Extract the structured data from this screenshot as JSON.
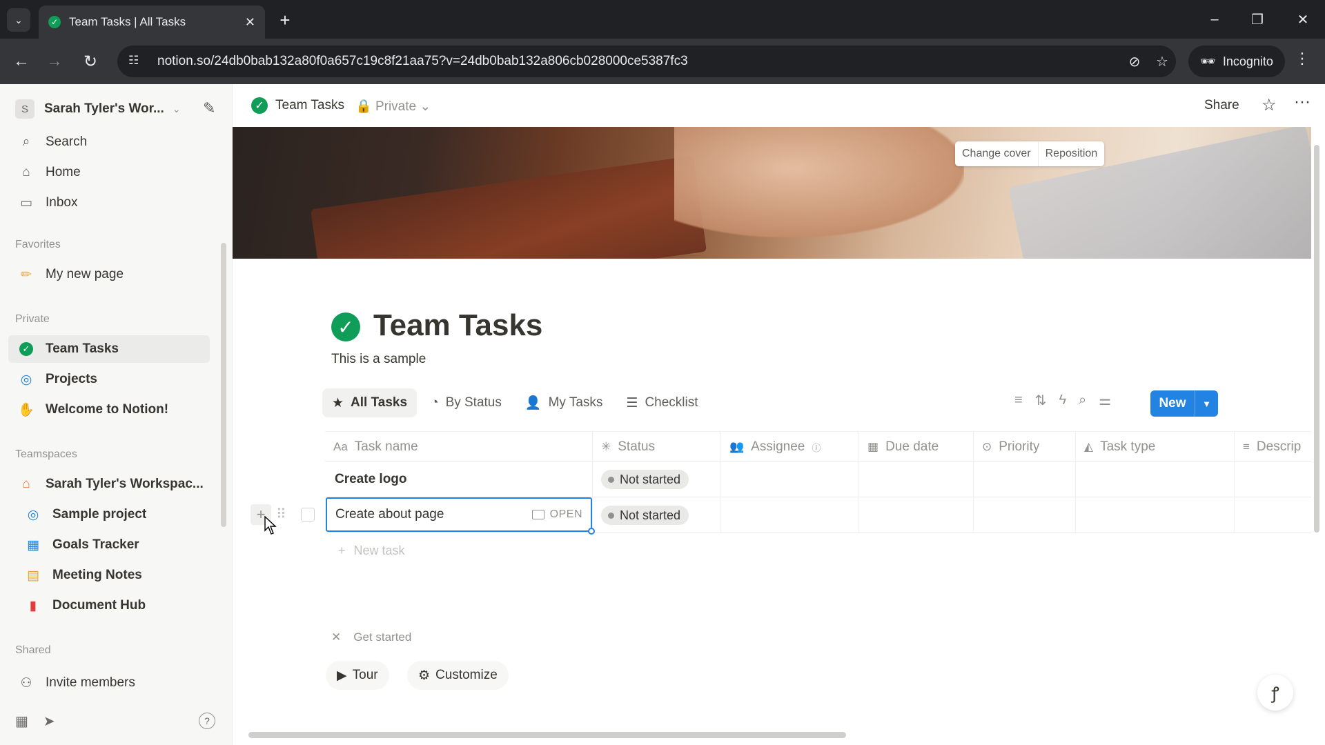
{
  "browser": {
    "tab_title": "Team Tasks | All Tasks",
    "url": "notion.so/24db0bab132a80f0a657c19c8f21aa75?v=24db0bab132a806cb028000ce5387fc3",
    "incognito_label": "Incognito"
  },
  "sidebar": {
    "workspace_initial": "S",
    "workspace_name": "Sarah Tyler's Wor...",
    "nav": [
      {
        "label": "Search",
        "icon": "search-icon"
      },
      {
        "label": "Home",
        "icon": "home-icon"
      },
      {
        "label": "Inbox",
        "icon": "inbox-icon"
      }
    ],
    "favorites_header": "Favorites",
    "favorites": [
      {
        "label": "My new page",
        "icon": "pencil-icon"
      }
    ],
    "private_header": "Private",
    "private": [
      {
        "label": "Team Tasks",
        "icon": "check-circle-icon"
      },
      {
        "label": "Projects",
        "icon": "target-icon"
      },
      {
        "label": "Welcome to Notion!",
        "icon": "wave-icon"
      }
    ],
    "teamspaces_header": "Teamspaces",
    "teamspaces": [
      {
        "label": "Sarah Tyler's Workspac...",
        "icon": "house-icon"
      },
      {
        "label": "Sample project",
        "icon": "target-icon"
      },
      {
        "label": "Goals Tracker",
        "icon": "chart-icon"
      },
      {
        "label": "Meeting Notes",
        "icon": "calendar-icon"
      },
      {
        "label": "Document Hub",
        "icon": "document-icon"
      }
    ],
    "shared_header": "Shared",
    "invite_label": "Invite members"
  },
  "topbar": {
    "page_title": "Team Tasks",
    "privacy": "Private",
    "share_label": "Share"
  },
  "cover": {
    "change_cover": "Change cover",
    "reposition": "Reposition"
  },
  "page": {
    "title": "Team Tasks",
    "description": "This is a sample"
  },
  "views": [
    {
      "label": "All Tasks",
      "icon": "star-icon"
    },
    {
      "label": "By Status",
      "icon": "status-icon"
    },
    {
      "label": "My Tasks",
      "icon": "person-icon"
    },
    {
      "label": "Checklist",
      "icon": "checklist-icon"
    }
  ],
  "new_button": "New",
  "table": {
    "columns": [
      {
        "label": "Task name",
        "icon": "Aa"
      },
      {
        "label": "Status",
        "icon": "status-icon"
      },
      {
        "label": "Assignee",
        "icon": "people-icon"
      },
      {
        "label": "Due date",
        "icon": "calendar-icon"
      },
      {
        "label": "Priority",
        "icon": "priority-icon"
      },
      {
        "label": "Task type",
        "icon": "shapes-icon"
      },
      {
        "label": "Descrip",
        "icon": "text-icon"
      }
    ],
    "rows": [
      {
        "task": "Create logo",
        "status": "Not started"
      },
      {
        "task": "Create about page",
        "status": "Not started"
      }
    ],
    "open_label": "OPEN",
    "new_task_label": "New task"
  },
  "get_started": {
    "label": "Get started",
    "tour": "Tour",
    "customize": "Customize"
  },
  "colors": {
    "accent": "#2383e2",
    "check_green": "#0f9d58",
    "sidebar_bg": "#f7f7f5"
  }
}
